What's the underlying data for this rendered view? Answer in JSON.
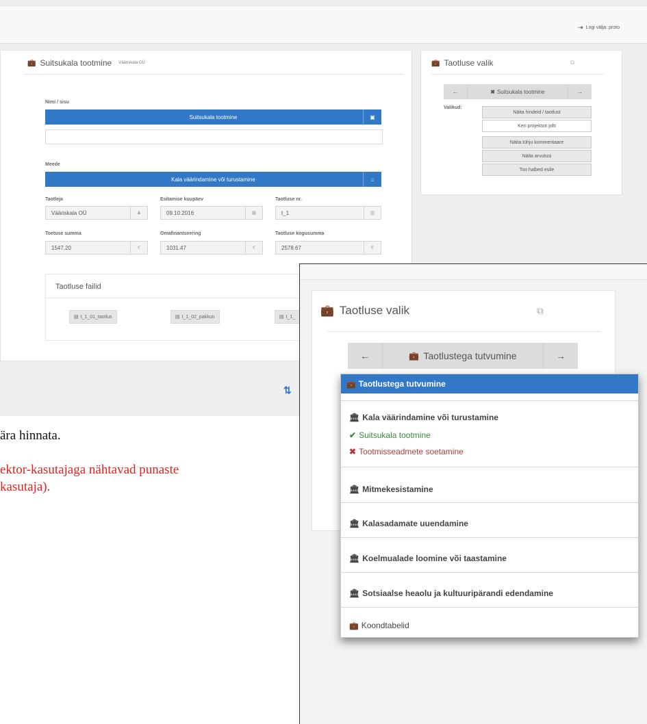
{
  "header": {
    "logout_label": "Logi välja: proto",
    "logout_icon": "sign-out-icon"
  },
  "application": {
    "title": "Suitsukala tootmine",
    "applicant_sub": "Vääriskala OÜ",
    "name_label": "Nimi / sisu",
    "name_value": "Suitsukala tootmine",
    "measure_label": "Meede",
    "measure_value": "Kala väärindamine või turustamine",
    "fields": [
      {
        "label": "Taotleja",
        "value": "Vääriskala OÜ",
        "icon": "user-icon"
      },
      {
        "label": "Esitamise kuupäev",
        "value": "09.10.2016",
        "icon": "calendar-icon"
      },
      {
        "label": "Taotluse nr.",
        "value": "t_1",
        "icon": "barcode-icon"
      },
      {
        "label": "Toetuse summa",
        "value": "1547.20",
        "icon": "euro-icon"
      },
      {
        "label": "Omafinantseering",
        "value": "1031.47",
        "icon": "euro-icon"
      },
      {
        "label": "Taotluse kogusumma",
        "value": "2578.67",
        "icon": "euro-icon"
      }
    ],
    "files_title": "Taotluse failid",
    "files": [
      "t_1_01_taotlus",
      "t_1_02_pakkun",
      "t_1_"
    ]
  },
  "side_panel": {
    "title": "Taotluse valik",
    "nav_current": "Suitsukala tootmine",
    "options_label": "Valikud:",
    "options": [
      "Näita hindeid / taotlust",
      "Keri projektori pilti",
      "Näita tühju kommentaare",
      "Näita arvutusi",
      "Too halbed esile"
    ]
  },
  "body_text": {
    "line1": "ära hinnata.",
    "line2": "ektor-kasutajaga nähtavad punaste",
    "line3": "kasutaja)."
  },
  "zoom": {
    "title": "Taotluse valik",
    "nav_current": "Taotlustega tutvumine",
    "dropdown": {
      "active": "Taotlustega tutvumine",
      "group1_title": "Kala väärindamine või turustamine",
      "group1_ok": "Suitsukala tootmine",
      "group1_bad": "Tootmisseadmete soetamine",
      "groups": [
        "Mitmekesistamine",
        "Kalasadamate uuendamine",
        "Koelmualade loomine või taastamine",
        "Sotsiaalse heaolu ja kultuuripärandi edendamine"
      ],
      "footer": "Koondtabelid"
    }
  },
  "colors": {
    "primary": "#3178c6",
    "ok": "#3c8a3c",
    "bad": "#b03a3a",
    "red_text": "#e8201c"
  }
}
